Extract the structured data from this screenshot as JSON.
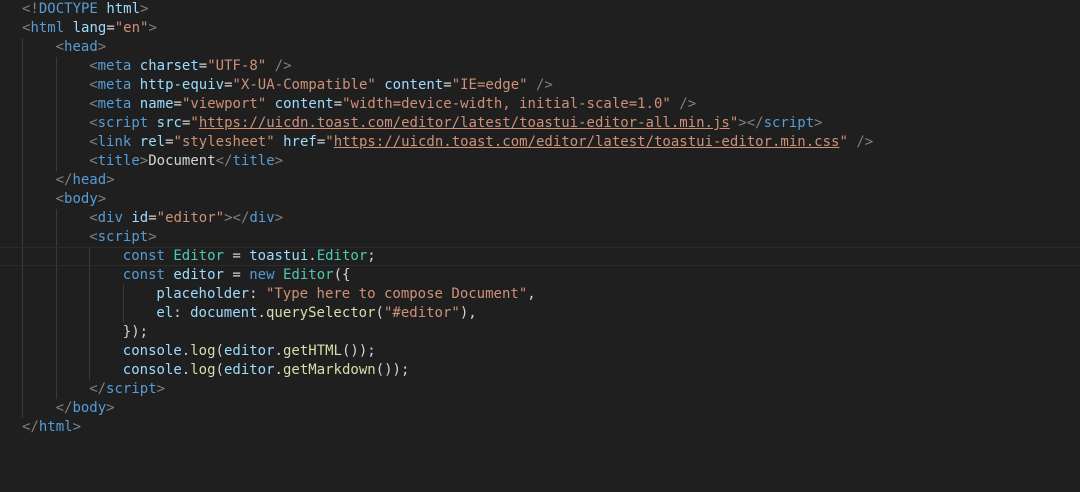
{
  "code": {
    "lines": [
      {
        "indent": 0,
        "tokens": [
          [
            "punct",
            "<!"
          ],
          [
            "doctype",
            "DOCTYPE"
          ],
          [
            "text",
            " "
          ],
          [
            "attr",
            "html"
          ],
          [
            "punct",
            ">"
          ]
        ]
      },
      {
        "indent": 0,
        "tokens": [
          [
            "punct",
            "<"
          ],
          [
            "tag",
            "html"
          ],
          [
            "text",
            " "
          ],
          [
            "attr",
            "lang"
          ],
          [
            "text",
            "="
          ],
          [
            "str",
            "\"en\""
          ],
          [
            "punct",
            ">"
          ]
        ]
      },
      {
        "indent": 1,
        "tokens": [
          [
            "punct",
            "<"
          ],
          [
            "tag",
            "head"
          ],
          [
            "punct",
            ">"
          ]
        ]
      },
      {
        "indent": 2,
        "tokens": [
          [
            "punct",
            "<"
          ],
          [
            "tag",
            "meta"
          ],
          [
            "text",
            " "
          ],
          [
            "attr",
            "charset"
          ],
          [
            "text",
            "="
          ],
          [
            "str",
            "\"UTF-8\""
          ],
          [
            "text",
            " "
          ],
          [
            "punct",
            "/>"
          ]
        ]
      },
      {
        "indent": 2,
        "tokens": [
          [
            "punct",
            "<"
          ],
          [
            "tag",
            "meta"
          ],
          [
            "text",
            " "
          ],
          [
            "attr",
            "http-equiv"
          ],
          [
            "text",
            "="
          ],
          [
            "str",
            "\"X-UA-Compatible\""
          ],
          [
            "text",
            " "
          ],
          [
            "attr",
            "content"
          ],
          [
            "text",
            "="
          ],
          [
            "str",
            "\"IE=edge\""
          ],
          [
            "text",
            " "
          ],
          [
            "punct",
            "/>"
          ]
        ]
      },
      {
        "indent": 2,
        "tokens": [
          [
            "punct",
            "<"
          ],
          [
            "tag",
            "meta"
          ],
          [
            "text",
            " "
          ],
          [
            "attr",
            "name"
          ],
          [
            "text",
            "="
          ],
          [
            "str",
            "\"viewport\""
          ],
          [
            "text",
            " "
          ],
          [
            "attr",
            "content"
          ],
          [
            "text",
            "="
          ],
          [
            "str",
            "\"width=device-width, initial-scale=1.0\""
          ],
          [
            "text",
            " "
          ],
          [
            "punct",
            "/>"
          ]
        ]
      },
      {
        "indent": 2,
        "tokens": [
          [
            "punct",
            "<"
          ],
          [
            "tag",
            "script"
          ],
          [
            "text",
            " "
          ],
          [
            "attr",
            "src"
          ],
          [
            "text",
            "="
          ],
          [
            "str",
            "\""
          ],
          [
            "url",
            "https://uicdn.toast.com/editor/latest/toastui-editor-all.min.js"
          ],
          [
            "str",
            "\""
          ],
          [
            "punct",
            "></"
          ],
          [
            "tag",
            "script"
          ],
          [
            "punct",
            ">"
          ]
        ]
      },
      {
        "indent": 2,
        "tokens": [
          [
            "punct",
            "<"
          ],
          [
            "tag",
            "link"
          ],
          [
            "text",
            " "
          ],
          [
            "attr",
            "rel"
          ],
          [
            "text",
            "="
          ],
          [
            "str",
            "\"stylesheet\""
          ],
          [
            "text",
            " "
          ],
          [
            "attr",
            "href"
          ],
          [
            "text",
            "="
          ],
          [
            "str",
            "\""
          ],
          [
            "url",
            "https://uicdn.toast.com/editor/latest/toastui-editor.min.css"
          ],
          [
            "str",
            "\""
          ],
          [
            "text",
            " "
          ],
          [
            "punct",
            "/>"
          ]
        ]
      },
      {
        "indent": 2,
        "tokens": [
          [
            "punct",
            "<"
          ],
          [
            "tag",
            "title"
          ],
          [
            "punct",
            ">"
          ],
          [
            "text",
            "Document"
          ],
          [
            "punct",
            "</"
          ],
          [
            "tag",
            "title"
          ],
          [
            "punct",
            ">"
          ]
        ]
      },
      {
        "indent": 1,
        "tokens": [
          [
            "punct",
            "</"
          ],
          [
            "tag",
            "head"
          ],
          [
            "punct",
            ">"
          ]
        ]
      },
      {
        "indent": 1,
        "tokens": [
          [
            "punct",
            "<"
          ],
          [
            "tag",
            "body"
          ],
          [
            "punct",
            ">"
          ]
        ]
      },
      {
        "indent": 2,
        "tokens": [
          [
            "punct",
            "<"
          ],
          [
            "tag",
            "div"
          ],
          [
            "text",
            " "
          ],
          [
            "attr",
            "id"
          ],
          [
            "text",
            "="
          ],
          [
            "str",
            "\"editor\""
          ],
          [
            "punct",
            "></"
          ],
          [
            "tag",
            "div"
          ],
          [
            "punct",
            ">"
          ]
        ]
      },
      {
        "indent": 2,
        "tokens": [
          [
            "punct",
            "<"
          ],
          [
            "tag",
            "script"
          ],
          [
            "punct",
            ">"
          ]
        ]
      },
      {
        "indent": 3,
        "current": true,
        "tokens": [
          [
            "kw",
            "const"
          ],
          [
            "text",
            " "
          ],
          [
            "cls",
            "Editor"
          ],
          [
            "text",
            " = "
          ],
          [
            "var",
            "toastui"
          ],
          [
            "text",
            "."
          ],
          [
            "cls",
            "Editor"
          ],
          [
            "text",
            ";"
          ]
        ]
      },
      {
        "indent": 3,
        "tokens": [
          [
            "kw",
            "const"
          ],
          [
            "text",
            " "
          ],
          [
            "var",
            "editor"
          ],
          [
            "text",
            " = "
          ],
          [
            "kw",
            "new"
          ],
          [
            "text",
            " "
          ],
          [
            "cls",
            "Editor"
          ],
          [
            "text",
            "({"
          ]
        ]
      },
      {
        "indent": 4,
        "tokens": [
          [
            "var",
            "placeholder"
          ],
          [
            "text",
            ": "
          ],
          [
            "str",
            "\"Type here to compose Document\""
          ],
          [
            "text",
            ","
          ]
        ]
      },
      {
        "indent": 4,
        "tokens": [
          [
            "var",
            "el"
          ],
          [
            "text",
            ": "
          ],
          [
            "var",
            "document"
          ],
          [
            "text",
            "."
          ],
          [
            "fn",
            "querySelector"
          ],
          [
            "text",
            "("
          ],
          [
            "str",
            "\"#editor\""
          ],
          [
            "text",
            "),"
          ]
        ]
      },
      {
        "indent": 3,
        "tokens": [
          [
            "text",
            "});"
          ]
        ]
      },
      {
        "indent": 3,
        "tokens": [
          [
            "var",
            "console"
          ],
          [
            "text",
            "."
          ],
          [
            "fn",
            "log"
          ],
          [
            "text",
            "("
          ],
          [
            "var",
            "editor"
          ],
          [
            "text",
            "."
          ],
          [
            "fn",
            "getHTML"
          ],
          [
            "text",
            "());"
          ]
        ]
      },
      {
        "indent": 3,
        "tokens": [
          [
            "var",
            "console"
          ],
          [
            "text",
            "."
          ],
          [
            "fn",
            "log"
          ],
          [
            "text",
            "("
          ],
          [
            "var",
            "editor"
          ],
          [
            "text",
            "."
          ],
          [
            "fn",
            "getMarkdown"
          ],
          [
            "text",
            "());"
          ]
        ]
      },
      {
        "indent": 2,
        "tokens": [
          [
            "punct",
            "</"
          ],
          [
            "tag",
            "script"
          ],
          [
            "punct",
            ">"
          ]
        ]
      },
      {
        "indent": 1,
        "tokens": [
          [
            "punct",
            "</"
          ],
          [
            "tag",
            "body"
          ],
          [
            "punct",
            ">"
          ]
        ]
      },
      {
        "indent": 0,
        "tokens": [
          [
            "punct",
            "</"
          ],
          [
            "tag",
            "html"
          ],
          [
            "punct",
            ">"
          ]
        ]
      }
    ]
  },
  "colors": {
    "background": "#1f1f1f",
    "tag": "#569cd6",
    "attribute": "#9cdcfe",
    "string": "#ce9178",
    "class": "#4ec9b0",
    "function": "#dcdcaa",
    "punctuation": "#808080",
    "text": "#d4d4d4"
  }
}
